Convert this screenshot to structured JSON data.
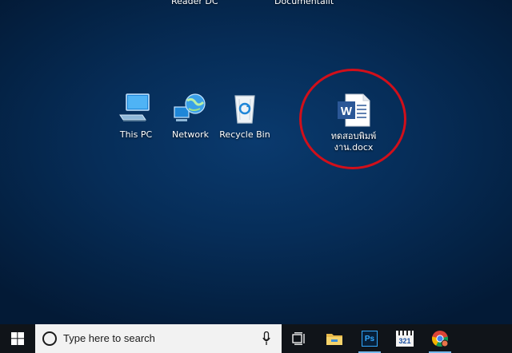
{
  "desktop": {
    "partial_labels": [
      "Reader DC",
      "Documentalit"
    ],
    "icons": [
      {
        "label": "This PC",
        "icon": "this-pc-icon"
      },
      {
        "label": "Network",
        "icon": "network-icon"
      },
      {
        "label": "Recycle Bin",
        "icon": "recycle-bin-icon"
      },
      {
        "label": "ทดสอบพิมพ์งาน.docx",
        "icon": "word-document-icon"
      }
    ],
    "highlight_color": "#d10f1a"
  },
  "taskbar": {
    "search_placeholder": "Type here to search",
    "pinned": [
      "task-view-icon",
      "file-explorer-icon",
      "photoshop-icon",
      "media-player-classic-icon",
      "chrome-icon"
    ],
    "photoshop_label": "Ps",
    "media_label": "321",
    "accent": "#76b9ed"
  }
}
